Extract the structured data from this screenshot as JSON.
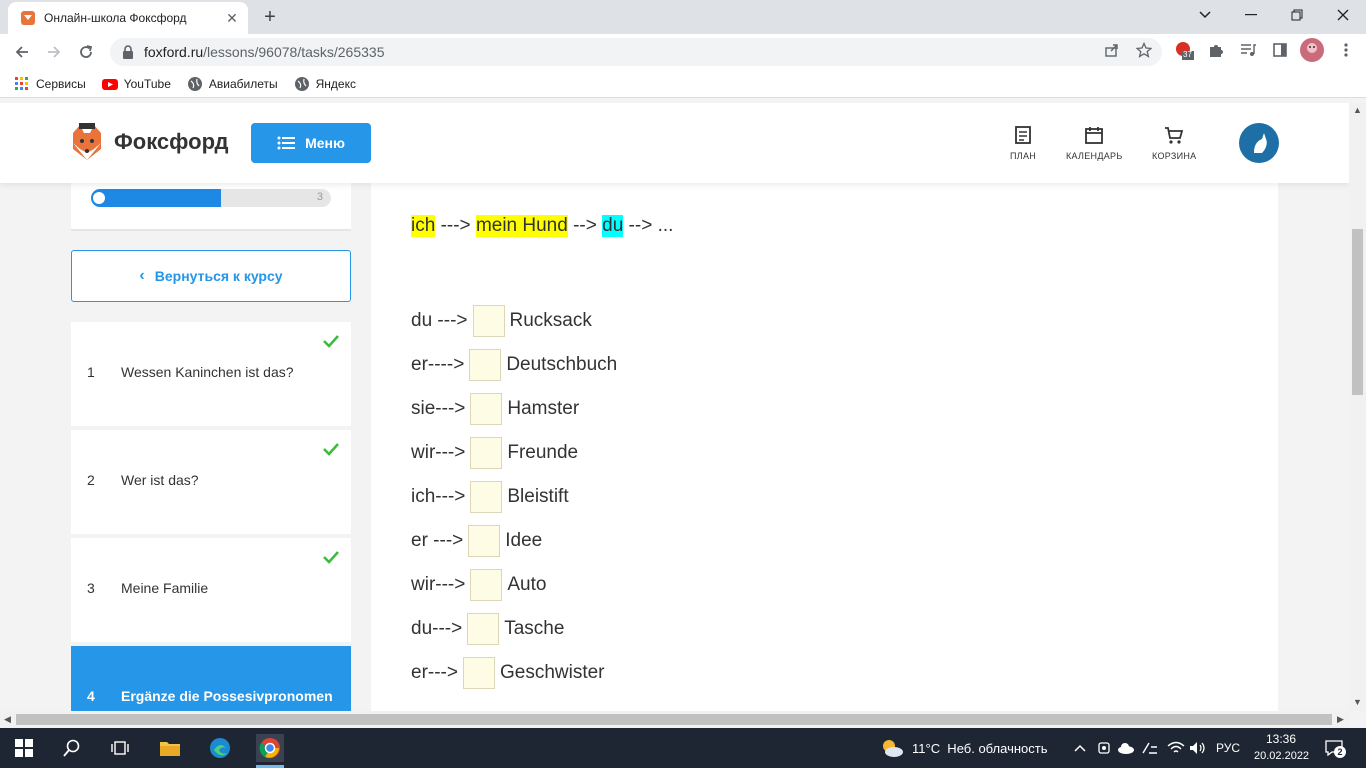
{
  "browser": {
    "tab_title": "Онлайн-школа Фоксфорд",
    "url_domain": "foxford.ru",
    "url_path": "/lessons/96078/tasks/265335",
    "extension_badge": "37",
    "bookmarks": [
      "Сервисы",
      "YouTube",
      "Авиабилеты",
      "Яндекс"
    ]
  },
  "header": {
    "logo_text": "Фоксфорд",
    "menu_label": "Меню",
    "nav": [
      {
        "label": "ПЛАН",
        "icon": "plan-icon"
      },
      {
        "label": "КАЛЕНДАРЬ",
        "icon": "calendar-icon"
      },
      {
        "label": "КОРЗИНА",
        "icon": "cart-icon"
      }
    ]
  },
  "sidebar": {
    "progress_end": "3",
    "progress_fraction": 0.54,
    "back_label": "Вернуться к курсу",
    "lessons": [
      {
        "num": "1",
        "title": "Wessen Kaninchen ist das?",
        "done": true
      },
      {
        "num": "2",
        "title": "Wer ist das?",
        "done": true
      },
      {
        "num": "3",
        "title": "Meine Familie",
        "done": true
      },
      {
        "num": "4",
        "title": "Ergänze die Possesivpronomen",
        "done": false
      }
    ]
  },
  "task": {
    "example": {
      "w1": "ich",
      "a1": " ---> ",
      "w2": "mein Hund",
      "a2": " --> ",
      "w3": "du",
      "a3": " --> ..."
    },
    "rows": [
      {
        "prefix": "du --->",
        "noun": "Rucksack"
      },
      {
        "prefix": "er---->",
        "noun": "Deutschbuch"
      },
      {
        "prefix": "sie--->",
        "noun": "Hamster"
      },
      {
        "prefix": "wir--->",
        "noun": "Freunde"
      },
      {
        "prefix": "ich--->",
        "noun": "Bleistift"
      },
      {
        "prefix": "er --->",
        "noun": "Idee"
      },
      {
        "prefix": "wir--->",
        "noun": "Auto"
      },
      {
        "prefix": "du--->",
        "noun": "Tasche"
      },
      {
        "prefix": "er--->",
        "noun": "Geschwister"
      }
    ]
  },
  "taskbar": {
    "weather": "11°C  Неб. облачность",
    "lang": "РУС",
    "time": "13:36",
    "date": "20.02.2022"
  }
}
